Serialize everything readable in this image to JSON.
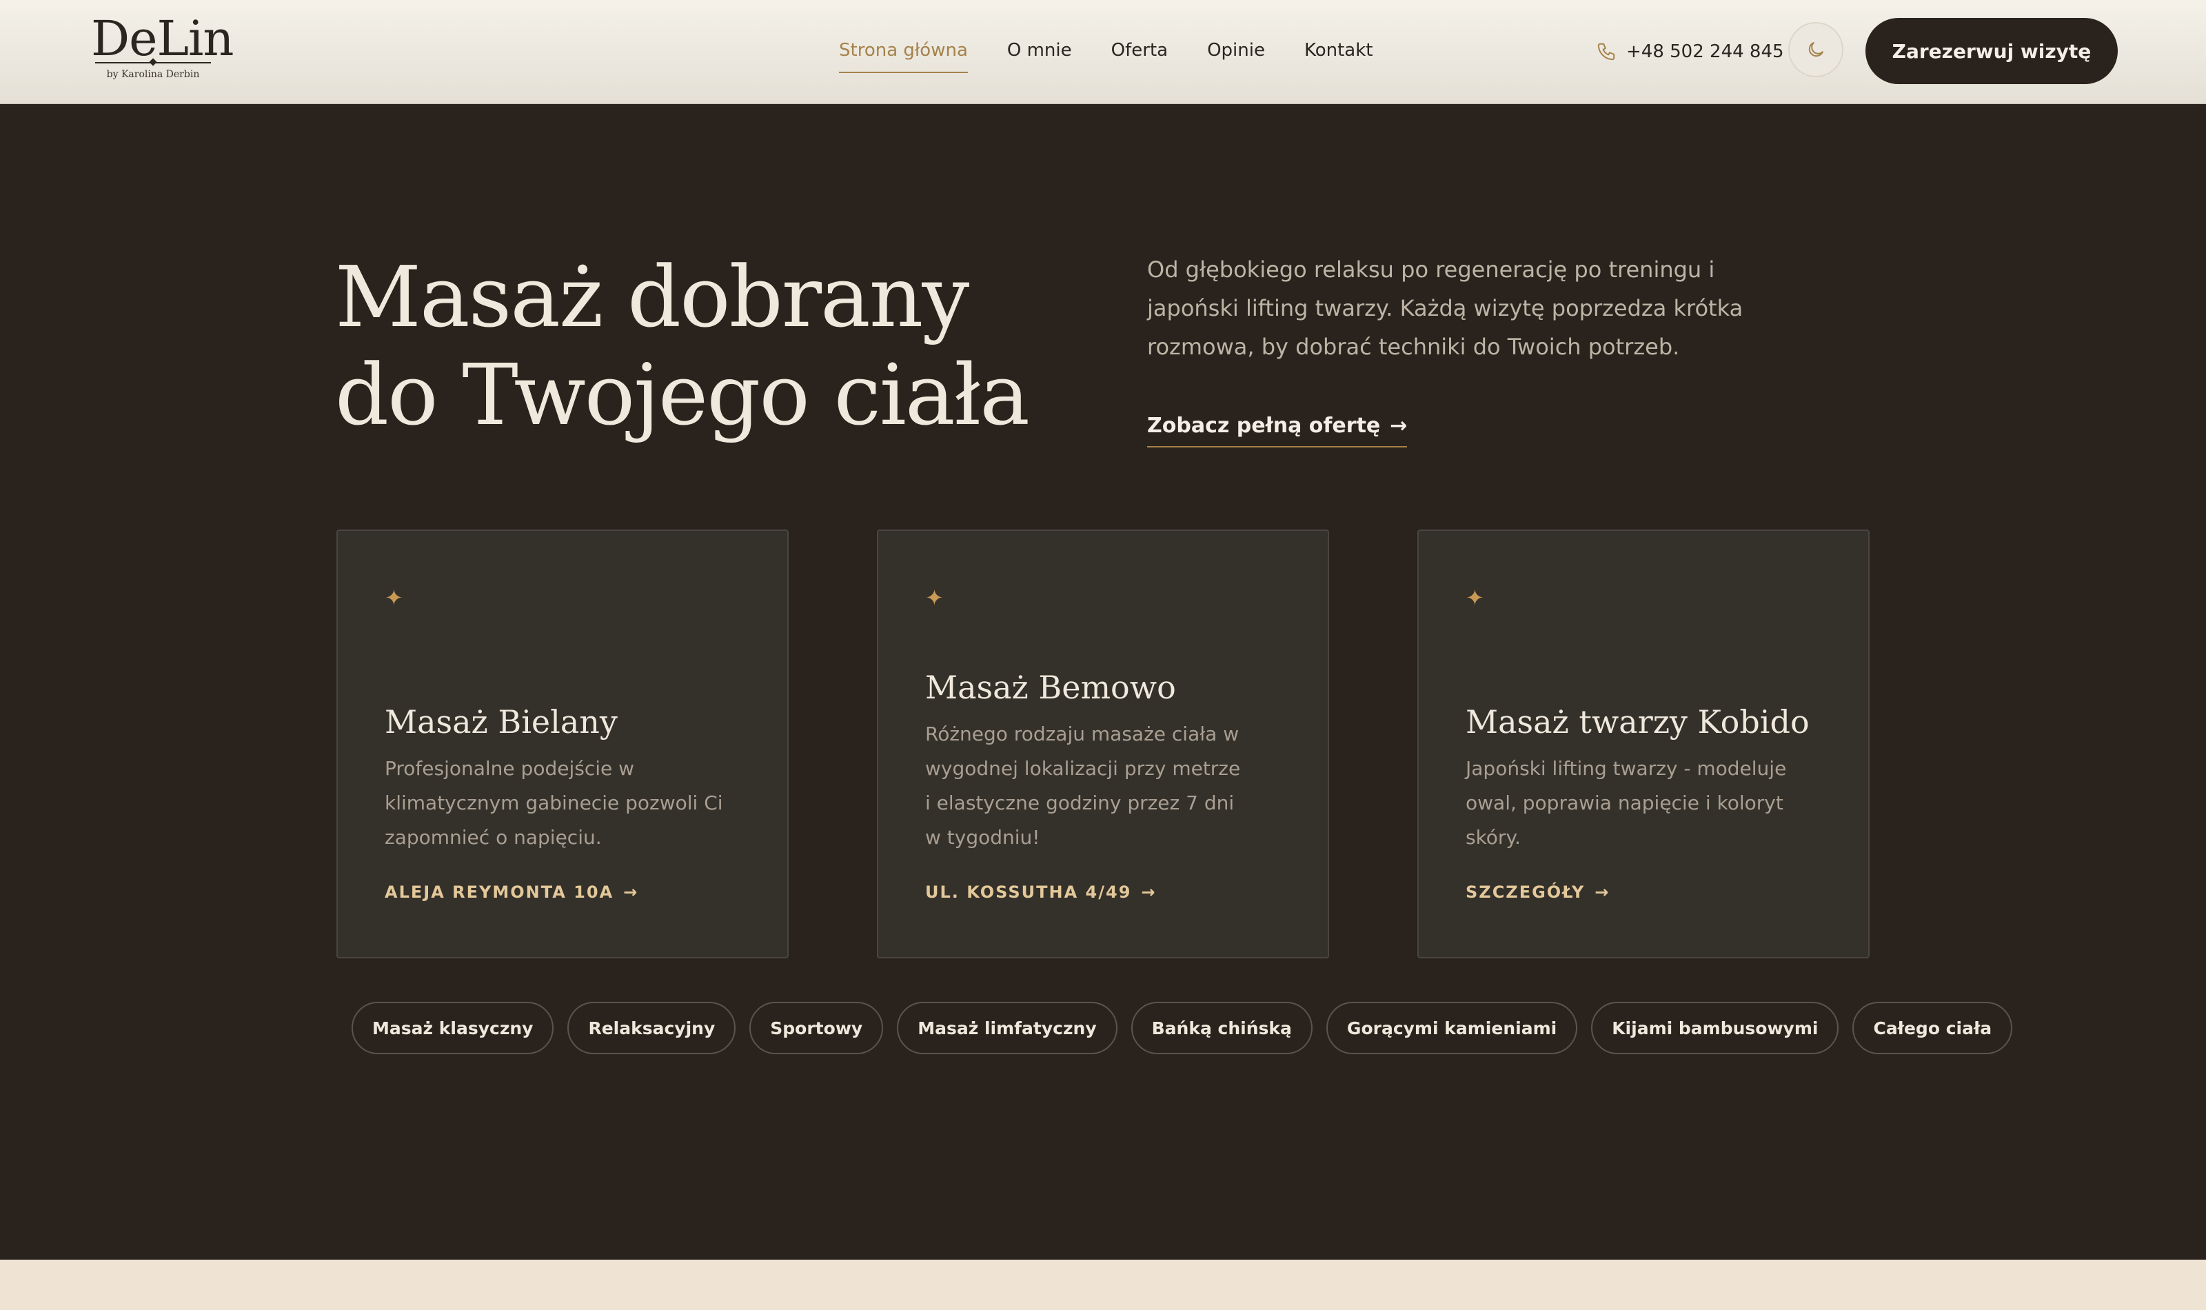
{
  "brand": {
    "name": "DeLin",
    "tagline": "by Karolina Derbin"
  },
  "nav": {
    "items": [
      {
        "label": "Strona główna",
        "active": true
      },
      {
        "label": "O mnie",
        "active": false
      },
      {
        "label": "Oferta",
        "active": false
      },
      {
        "label": "Opinie",
        "active": false
      },
      {
        "label": "Kontakt",
        "active": false
      }
    ]
  },
  "header": {
    "phone": "+48 502 244 845",
    "phone_icon": "phone-icon",
    "theme_icon": "moon-icon",
    "cta_label": "Zarezerwuj wizytę"
  },
  "hero": {
    "title_line1": "Masaż dobrany",
    "title_line2": "do Twojego ciała",
    "description": "Od głębokiego relaksu po regenerację po treningu i japoński lifting twarzy. Każdą wizytę poprzedza krótka rozmowa, by dobrać techniki do Twoich potrzeb.",
    "link_label": "Zobacz pełną ofertę",
    "link_arrow": "→"
  },
  "cards": [
    {
      "icon": "✦",
      "title": "Masaż Bielany",
      "text": "Profesjonalne podejście w klimatycznym gabinecie pozwoli Ci zapomnieć o napięciu.",
      "link": "ALEJA REYMONTA 10A",
      "arrow": "→"
    },
    {
      "icon": "✦",
      "title": "Masaż Bemowo",
      "text": "Różnego rodzaju masaże ciała w wygodnej lokalizacji przy metrze i elastyczne godziny przez 7 dni w tygodniu!",
      "link": "UL. KOSSUTHA 4/49",
      "arrow": "→"
    },
    {
      "icon": "✦",
      "title": "Masaż twarzy Kobido",
      "text": "Japoński lifting twarzy - modeluje owal, poprawia napięcie i koloryt skóry.",
      "link": "SZCZEGÓŁY",
      "arrow": "→"
    }
  ],
  "tags": [
    "Masaż klasyczny",
    "Relaksacyjny",
    "Sportowy",
    "Masaż limfatyczny",
    "Bańką chińską",
    "Gorącymi kamieniami",
    "Kijami bambusowymi",
    "Całego ciała"
  ],
  "colors": {
    "background": "#2a231d",
    "header": "#efebe3",
    "accent": "#a5824b",
    "card": "#34302a",
    "strip": "#efe4d4"
  }
}
